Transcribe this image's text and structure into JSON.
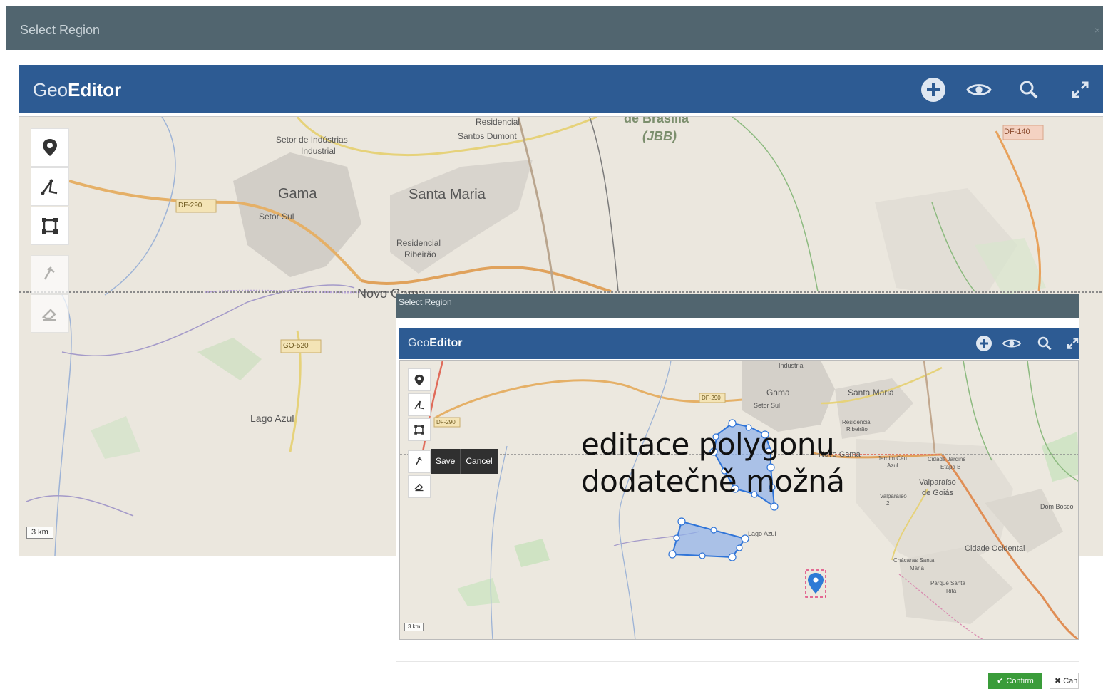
{
  "background_window": {
    "title": "Select Region",
    "close": "×",
    "header": {
      "brand_light": "Geo",
      "brand_bold": "Editor"
    },
    "scale": "3 km",
    "map_labels": {
      "gama": "Gama",
      "setor_sul": "Setor Sul",
      "setor_industrias": "Setor de Indústrias",
      "industrial": "Industrial",
      "santa_maria": "Santa Maria",
      "res_ribeirao_1": "Residencial",
      "res_ribeirao_2": "Ribeirão",
      "res_santos_1": "Residencial",
      "res_santos_2": "Santos Dumont",
      "de_brasilia": "de Brasília",
      "jbb": "(JBB)",
      "novo_gama": "Novo Gama",
      "lago_azul": "Lago Azul",
      "df290": "DF-290",
      "go520": "GO-520",
      "df140": "DF-140"
    }
  },
  "foreground_window": {
    "title": "Select Region",
    "header": {
      "brand_light": "Geo",
      "brand_bold": "Editor"
    },
    "edit_menu": {
      "save": "Save",
      "cancel": "Cancel"
    },
    "scale": "3 km",
    "map_labels": {
      "industrial": "Industrial",
      "gama": "Gama",
      "setor_sul": "Setor Sul",
      "santa_maria": "Santa Maria",
      "res_1": "Residencial",
      "res_2": "Ribeirão",
      "df290_a": "DF-290",
      "df290_b": "DF-290",
      "novo_gama": "Novo Gama",
      "jardim_ceu_1": "Jardim Céu",
      "jardim_ceu_2": "Azul",
      "cidade_jardins_1": "Cidade Jardins",
      "cidade_jardins_2": "Etapa B",
      "valparaiso_1": "Valparaíso",
      "valparaiso_2": "de Goiás",
      "valparaiso_small_1": "Valparaíso",
      "valparaiso_small_2": "2",
      "dom_bosco": "Dom Bosco",
      "lago_azul": "Lago Azul",
      "cidade_ocidental": "Cidade Ocidental",
      "chacaras_1": "Chácaras Santa",
      "chacaras_2": "Maria",
      "parque_1": "Parque Santa",
      "parque_2": "Rita"
    },
    "confirm": "Confirm",
    "cancel": "Can"
  },
  "overlay_text": {
    "line1": "editace polygonu",
    "line2": "dodatečně možná"
  },
  "colors": {
    "titlebar": "#51656f",
    "header": "#2d5b93",
    "confirm": "#3a9c3a",
    "polygon_fill": "#8fb0ea",
    "polygon_stroke": "#2f74d8"
  }
}
